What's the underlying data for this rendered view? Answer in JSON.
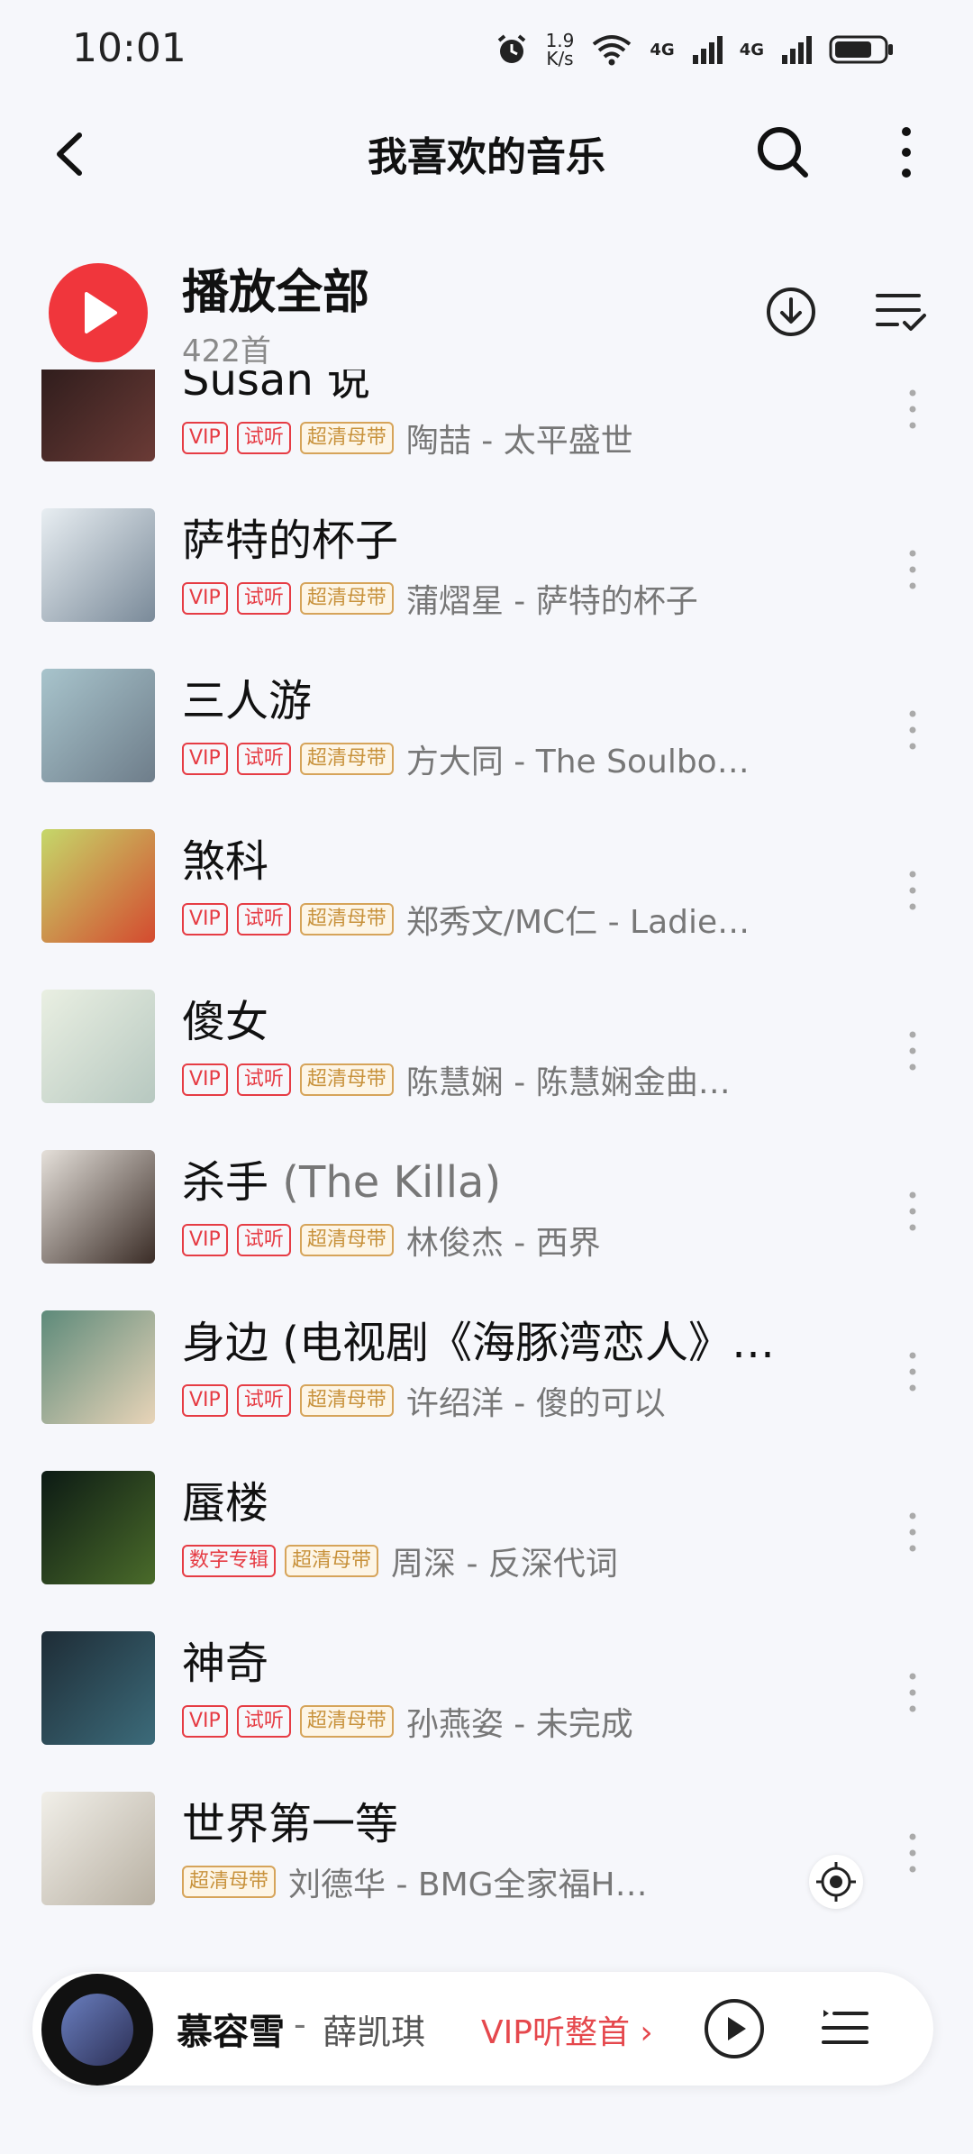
{
  "status_bar": {
    "time": "10:01",
    "speed_value": "1.9",
    "speed_unit": "K/s",
    "net1": "4G",
    "net2": "4G"
  },
  "header": {
    "title": "我喜欢的音乐"
  },
  "play_all": {
    "label": "播放全部",
    "count": "422首"
  },
  "tags": {
    "vip": "VIP",
    "trial": "试听",
    "hq": "超清母带",
    "digital": "数字专辑"
  },
  "songs": [
    {
      "title": "Susan 说",
      "artist": "陶喆 - 太平盛世",
      "cover": [
        "#2a1a1a",
        "#6b3b36"
      ]
    },
    {
      "title": "萨特的杯子",
      "artist": "蒲熠星 - 萨特的杯子",
      "cover": [
        "#e8eef2",
        "#7a8a99"
      ]
    },
    {
      "title": "三人游",
      "artist": "方大同 - The Soulbo…",
      "cover": [
        "#a8c4cc",
        "#6e7d8a"
      ]
    },
    {
      "title": "煞科",
      "artist": "郑秀文/MC仁 - Ladie…",
      "cover": [
        "#c5d86a",
        "#d44a2f"
      ]
    },
    {
      "title": "傻女",
      "artist": "陈慧娴 - 陈慧娴金曲…",
      "cover": [
        "#e9efe2",
        "#b7c8c0"
      ]
    },
    {
      "title": "杀手",
      "subtitle": "(The Killa)",
      "artist": "林俊杰 - 西界",
      "cover": [
        "#e5e0da",
        "#3a2c26"
      ]
    },
    {
      "title": "身边 (电视剧《海豚湾恋人》…",
      "artist": "许绍洋 - 傻的可以",
      "cover": [
        "#5d8a7a",
        "#e8d4b8"
      ]
    },
    {
      "title": "蜃楼",
      "artist": "周深 - 反深代词",
      "cover": [
        "#0c1a14",
        "#4a6b2a"
      ]
    },
    {
      "title": "神奇",
      "artist": "孙燕姿 - 未完成",
      "cover": [
        "#1e2c36",
        "#3c6b7a"
      ]
    },
    {
      "title": "世界第一等",
      "artist": "刘德华 - BMG全家福Happy F…",
      "cover": [
        "#f1efe9",
        "#b8b0a2"
      ]
    }
  ],
  "now_playing": {
    "title": "慕容雪",
    "separator": "-",
    "artist": "薛凯琪",
    "vip_label": "VIP听整首 ›"
  },
  "icons": {
    "back": "back-arrow-icon",
    "search": "search-icon",
    "more": "more-vertical-icon",
    "download": "download-icon",
    "sort": "multi-select-icon",
    "locate": "locate-icon",
    "queue": "playlist-icon"
  },
  "colors": {
    "accent": "#f0363c",
    "vip_red": "#e63c44",
    "hq_gold": "#c8923c"
  }
}
